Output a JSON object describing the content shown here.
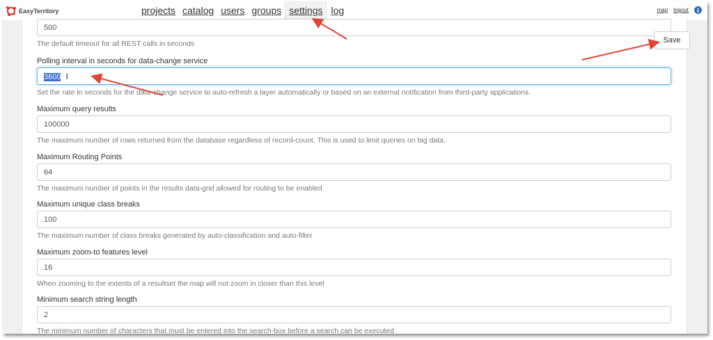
{
  "app": {
    "logo_text": "EasyTerritory"
  },
  "nav": {
    "items": [
      {
        "label": "projects"
      },
      {
        "label": "catalog"
      },
      {
        "label": "users"
      },
      {
        "label": "groups"
      },
      {
        "label": "settings"
      },
      {
        "label": "log"
      }
    ],
    "active": "settings"
  },
  "top_right": {
    "map_label": "map",
    "logout_label": "logout",
    "info_icon": "i"
  },
  "toolbar": {
    "save_label": "Save"
  },
  "settings": [
    {
      "label": "",
      "value": "500",
      "help": "The default timeout for all REST calls in seconds"
    },
    {
      "label": "Polling interval in seconds for data-change service",
      "value": "3600",
      "help": "Set the rate in seconds for the data-change service to auto-refresh a layer automatically or based on an external notification from third-party applications."
    },
    {
      "label": "Maximum query results",
      "value": "100000",
      "help": "The maximum number of rows returned from the database regardless of record-count. This is used to limit queries on big data."
    },
    {
      "label": "Maximum Routing Points",
      "value": "64",
      "help": "The maximum number of points in the results data-grid allowed for routing to be enabled"
    },
    {
      "label": "Maximum unique class breaks",
      "value": "100",
      "help": "The maximum number of class breaks generated by auto-classification and auto-filter"
    },
    {
      "label": "Maximum zoom-to features level",
      "value": "16",
      "help": "When zooming to the extents of a resultset the map will not zoom in closer than this level"
    },
    {
      "label": "Minimum search string length",
      "value": "2",
      "help": "The minimum number of characters that must be entered into the search-box before a search can be executed"
    }
  ],
  "annotation_color": "#e0453a"
}
